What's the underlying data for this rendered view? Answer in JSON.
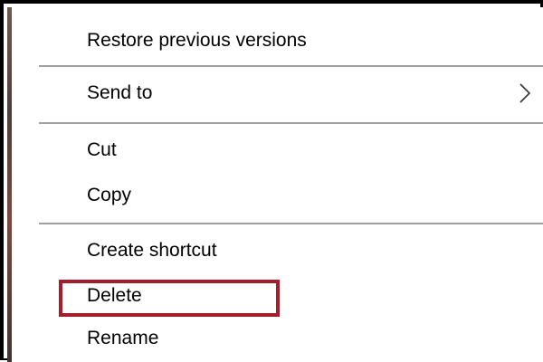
{
  "context_menu": {
    "items": [
      {
        "label": "Restore previous versions"
      },
      {
        "label": "Send to",
        "submenu_icon": "chevron-right-icon"
      },
      {
        "label": "Cut"
      },
      {
        "label": "Copy"
      },
      {
        "label": "Create shortcut"
      },
      {
        "label": "Delete",
        "highlighted": true
      },
      {
        "label": "Rename"
      }
    ]
  },
  "colors": {
    "highlight_border": "#a51d2b",
    "separator": "#a0a0a0",
    "frame": "#000000"
  }
}
